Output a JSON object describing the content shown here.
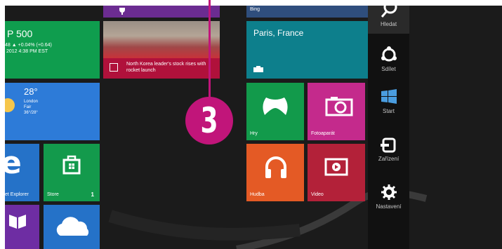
{
  "tiles": {
    "finance": {
      "price": "P 500",
      "change": "48 ▲ +0.04% (+0.64)",
      "date": "2012 4:38 PM EST"
    },
    "news": {
      "headline": "North Korea leader's stock rises with rocket launch"
    },
    "weather": {
      "temp": "28°",
      "city": "London",
      "condition": "Fair",
      "range": "36°/28°"
    },
    "ie": {
      "label": "et Explorer"
    },
    "store": {
      "label": "Store",
      "badge": "1"
    },
    "bing": {
      "label": "Bing"
    },
    "travel": {
      "place": "Paris, France"
    },
    "games": {
      "label": "Hry"
    },
    "camera": {
      "label": "Fotoaparát"
    },
    "music": {
      "label": "Hudba"
    },
    "video": {
      "label": "Video"
    }
  },
  "charms": {
    "search": "Hledat",
    "share": "Sdílet",
    "start": "Start",
    "devices": "Zařízení",
    "settings": "Nastavení"
  },
  "marker": {
    "number": "3"
  },
  "colors": {
    "accent_marker": "#c1157a",
    "finance": "#0f9d4e",
    "news": "#b0113b",
    "weather": "#2d7bd8",
    "travel": "#0d7f8c",
    "camera": "#c42a8c",
    "music": "#e45a25",
    "video": "#b32139"
  }
}
